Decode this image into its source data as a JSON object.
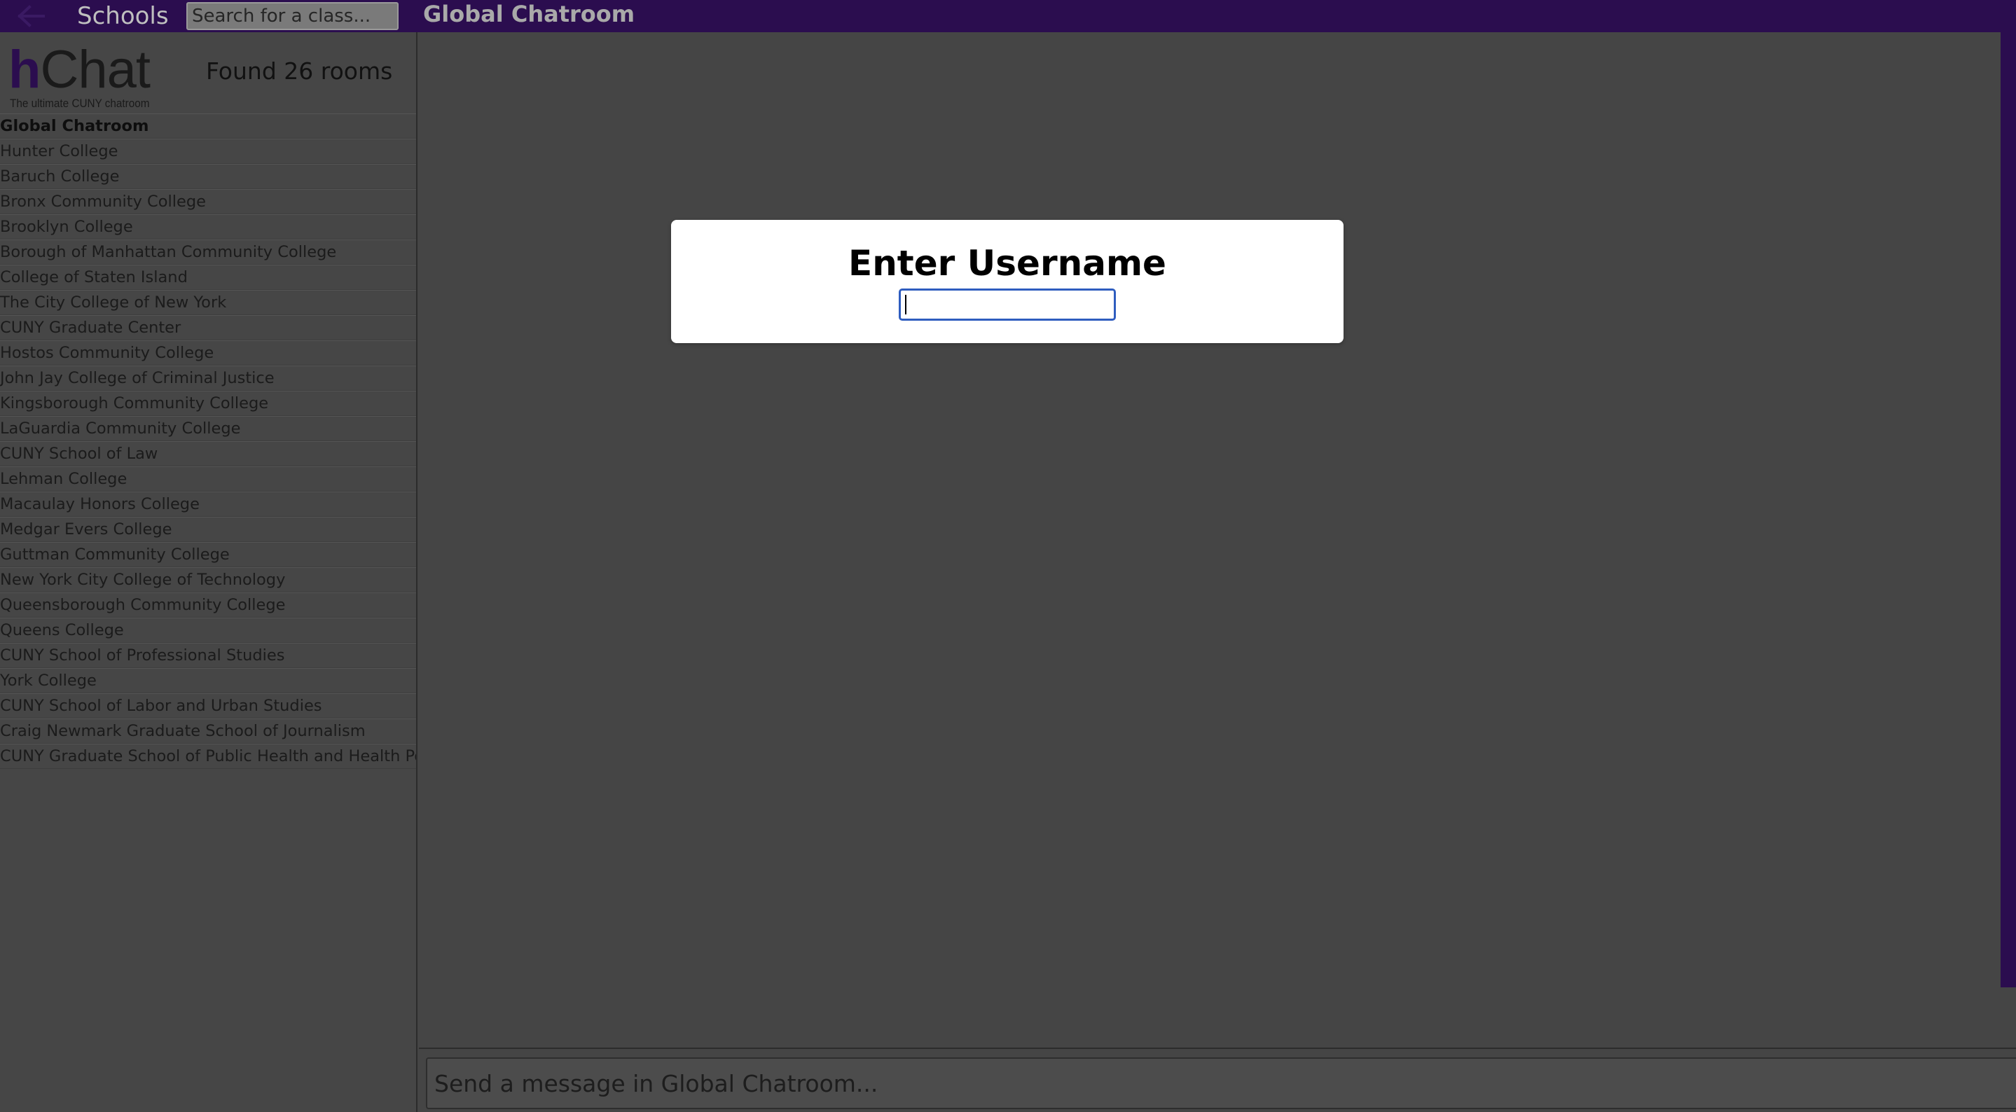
{
  "header": {
    "back_icon": "arrow-left-icon",
    "schools_label": "Schools",
    "search_placeholder": "Search for a class...",
    "room_title": "Global Chatroom"
  },
  "sidebar": {
    "logo": {
      "text_h": "h",
      "text_chat": "Chat",
      "tagline": "The ultimate CUNY chatroom"
    },
    "found_rooms": "Found 26 rooms",
    "rooms": [
      {
        "label": "Global Chatroom",
        "active": true
      },
      {
        "label": "Hunter College"
      },
      {
        "label": "Baruch College"
      },
      {
        "label": "Bronx Community College"
      },
      {
        "label": "Brooklyn College"
      },
      {
        "label": "Borough of Manhattan Community College"
      },
      {
        "label": "College of Staten Island"
      },
      {
        "label": "The City College of New York"
      },
      {
        "label": "CUNY Graduate Center"
      },
      {
        "label": "Hostos Community College"
      },
      {
        "label": "John Jay College of Criminal Justice"
      },
      {
        "label": "Kingsborough Community College"
      },
      {
        "label": "LaGuardia Community College"
      },
      {
        "label": "CUNY School of Law"
      },
      {
        "label": "Lehman College"
      },
      {
        "label": "Macaulay Honors College"
      },
      {
        "label": "Medgar Evers College"
      },
      {
        "label": "Guttman Community College"
      },
      {
        "label": "New York City College of Technology"
      },
      {
        "label": "Queensborough Community College"
      },
      {
        "label": "Queens College"
      },
      {
        "label": "CUNY School of Professional Studies"
      },
      {
        "label": "York College"
      },
      {
        "label": "CUNY School of Labor and Urban Studies"
      },
      {
        "label": "Craig Newmark Graduate School of Journalism"
      },
      {
        "label": "CUNY Graduate School of Public Health and Health Policy"
      }
    ]
  },
  "compose": {
    "placeholder": "Send a message in Global Chatroom..."
  },
  "modal": {
    "title": "Enter Username",
    "username_value": ""
  },
  "colors": {
    "brand_purple": "#2b0d4f",
    "background": "#454545",
    "input_focus": "#2f5dbf"
  }
}
